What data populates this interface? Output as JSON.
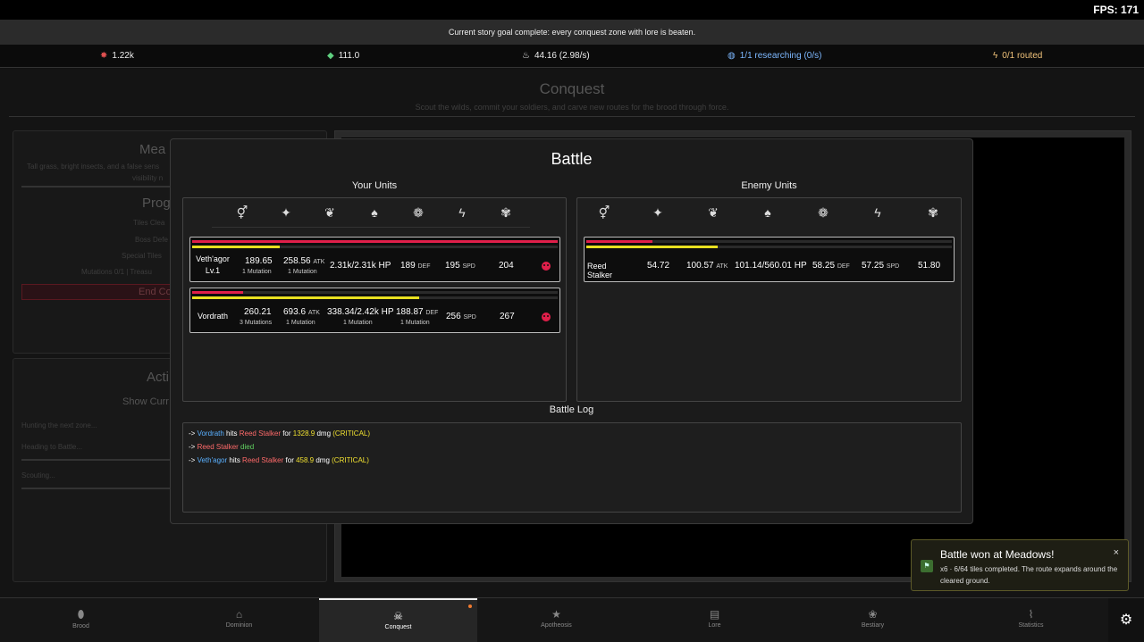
{
  "fps": "FPS: 171",
  "goal": "Current story goal complete: every conquest zone with lore is beaten.",
  "resources": [
    {
      "icon": "star-flower-icon",
      "glyph": "✸",
      "value": "1.22k",
      "color": "#e05050"
    },
    {
      "icon": "gem-icon",
      "glyph": "◆",
      "value": "111.0",
      "color": "#60d080"
    },
    {
      "icon": "flame-icon",
      "glyph": "♨",
      "value": "44.16 (2.98/s)",
      "color": "#ffffff"
    },
    {
      "icon": "research-icon",
      "glyph": "◍",
      "value": "1/1 researching (0/s)",
      "color": "#7db8ff"
    },
    {
      "icon": "lightning-icon",
      "glyph": "ϟ",
      "value": "0/1 routed",
      "color": "#f0c27a"
    }
  ],
  "page": {
    "title": "Conquest",
    "subtitle": "Scout the wilds, commit your soldiers, and carve new routes for the brood through force."
  },
  "left": {
    "zone_title": "Mea",
    "zone_desc1": "Tall grass, bright insects, and a false sens",
    "zone_desc2": "visibility n",
    "progress_title": "Prog",
    "tiles_cleared": "Tiles Clea",
    "boss_defeated": "Boss Defe",
    "special_tiles": "Special Tiles",
    "mutations": "Mutations 0/1  |  Treasu",
    "end_button": "End Co",
    "actions_title": "Acti",
    "show_current": "Show Curr",
    "activity1": "Hunting the next zone...",
    "activity2": "Heading to Battle...",
    "activity3": "Scouting..."
  },
  "battle": {
    "title": "Battle",
    "your_units_label": "Your Units",
    "enemy_units_label": "Enemy Units",
    "stat_icons": [
      {
        "name": "gender-icon",
        "glyph": "⚥"
      },
      {
        "name": "sparkle-icon",
        "glyph": "✦"
      },
      {
        "name": "claws-icon",
        "glyph": "❦"
      },
      {
        "name": "flame-drop-icon",
        "glyph": "♠"
      },
      {
        "name": "scales-icon",
        "glyph": "❁"
      },
      {
        "name": "speed-icon",
        "glyph": "ϟ"
      },
      {
        "name": "brain-icon",
        "glyph": "✾"
      }
    ],
    "your_units": [
      {
        "name": "Veth'agor",
        "level": "Lv.1",
        "hp_fraction": 1.0,
        "xp_fraction": 0.24,
        "stat1": "189.65",
        "stat1_sub": "1 Mutation",
        "atk": "258.56",
        "atk_unit": "ATK",
        "atk_sub": "1 Mutation",
        "hp": "2.31k/2.31k HP",
        "hp_sub": "",
        "def": "189",
        "def_unit": "DEF",
        "def_sub": "",
        "spd": "195",
        "spd_unit": "SPD",
        "last": "204"
      },
      {
        "name": "Vordrath",
        "level": "",
        "hp_fraction": 0.14,
        "xp_fraction": 0.62,
        "stat1": "260.21",
        "stat1_sub": "3 Mutations",
        "atk": "693.6",
        "atk_unit": "ATK",
        "atk_sub": "1 Mutation",
        "hp": "338.34/2.42k HP",
        "hp_sub": "1 Mutation",
        "def": "188.87",
        "def_unit": "DEF",
        "def_sub": "1 Mutation",
        "spd": "256",
        "spd_unit": "SPD",
        "last": "267"
      }
    ],
    "enemy_units": [
      {
        "name": "Reed Stalker",
        "hp_fraction": 0.18,
        "xp_fraction": 0.36,
        "stat1": "54.72",
        "atk": "100.57",
        "atk_unit": "ATK",
        "hp": "101.14/560.01 HP",
        "def": "58.25",
        "def_unit": "DEF",
        "spd": "57.25",
        "spd_unit": "SPD",
        "last": "51.80"
      }
    ],
    "log_title": "Battle Log",
    "log": [
      {
        "arrow": "->",
        "actor": "Vordrath",
        "verb": " hits ",
        "target": "Reed Stalker",
        "mid": " for ",
        "dmg": "1328.9",
        "unit": " dmg ",
        "tag": "(CRITICAL)"
      },
      {
        "arrow": "->",
        "actor": "Reed Stalker",
        "verb": " died"
      },
      {
        "arrow": "->",
        "actor": "Veth'agor",
        "verb": " hits ",
        "target": "Reed Stalker",
        "mid": " for ",
        "dmg": "458.9",
        "unit": " dmg ",
        "tag": "(CRITICAL)"
      }
    ]
  },
  "toast": {
    "title": "Battle won at Meadows!",
    "message": "x6 · 6/64 tiles completed. The route expands around the cleared ground.",
    "close": "×",
    "flag_glyph": "⚑"
  },
  "nav": [
    {
      "label": "Brood",
      "icon": "egg-icon",
      "glyph": "⬮"
    },
    {
      "label": "Dominion",
      "icon": "home-icon",
      "glyph": "⌂"
    },
    {
      "label": "Conquest",
      "icon": "skull-icon",
      "glyph": "☠",
      "active": true
    },
    {
      "label": "Apotheosis",
      "icon": "star-icon",
      "glyph": "★"
    },
    {
      "label": "Lore",
      "icon": "book-icon",
      "glyph": "▤"
    },
    {
      "label": "Bestiary",
      "icon": "paw-icon",
      "glyph": "❀"
    },
    {
      "label": "Statistics",
      "icon": "chart-icon",
      "glyph": "⌇"
    }
  ],
  "settings_glyph": "⚙"
}
